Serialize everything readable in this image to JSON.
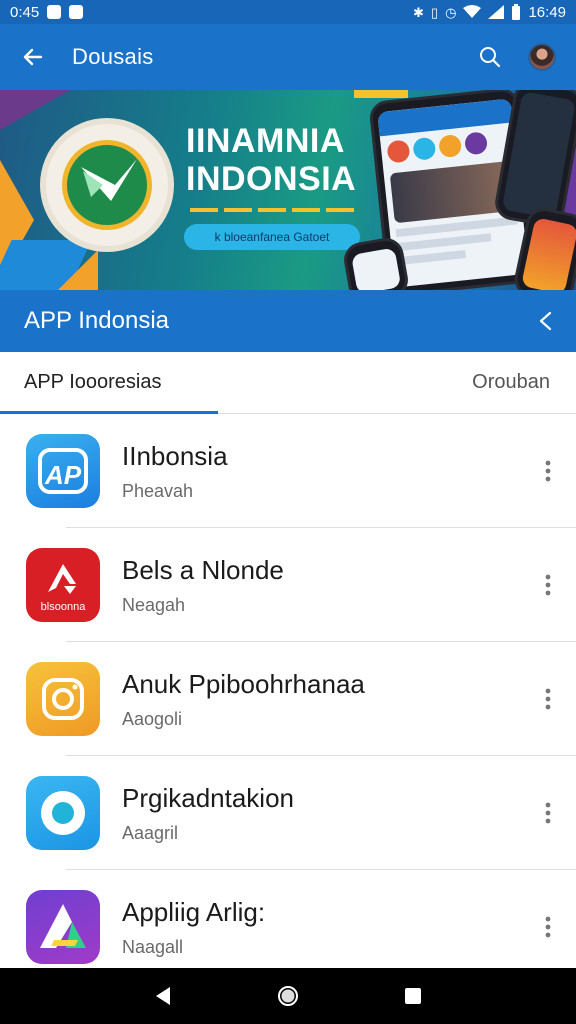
{
  "status": {
    "time": "0:45",
    "clock": "16:49"
  },
  "appbar": {
    "title": "Dousais"
  },
  "banner": {
    "title_line1": "IINAMNIA",
    "title_line2": "INDONSIA",
    "pill_text": "k bloeanfanea Gatoet"
  },
  "section": {
    "title": "APP Indonsia"
  },
  "tabs": {
    "left": "APP Ioooresias",
    "right": "Orouban"
  },
  "apps": [
    {
      "name": "IInbonsia",
      "sub": "Pheavah",
      "icon_text": "AP"
    },
    {
      "name": "Bels a Nlonde",
      "sub": "Neagah",
      "icon_text": "blsoonna"
    },
    {
      "name": "Anuk Ppiboohrhanaa",
      "sub": "Aaogoli"
    },
    {
      "name": "Prgikadntakion",
      "sub": "Aaagril"
    },
    {
      "name": "Appliig Arlig:",
      "sub": "Naagall"
    }
  ],
  "colors": {
    "primary": "#1a72c9",
    "statusbar": "#1766b8"
  }
}
